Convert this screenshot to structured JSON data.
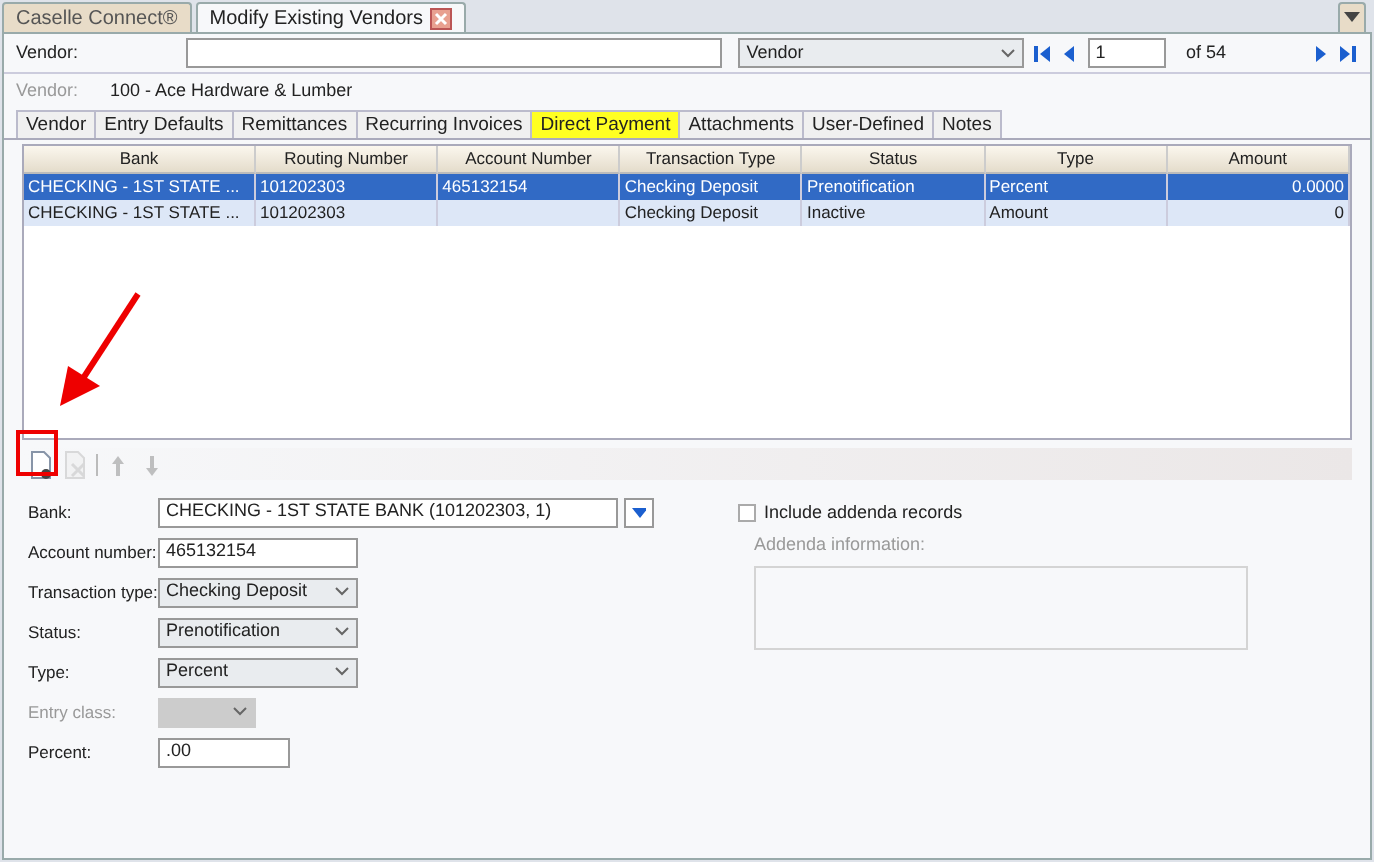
{
  "doc_tabs": [
    {
      "label": "Caselle Connect®",
      "selected": false,
      "closable": false
    },
    {
      "label": "Modify Existing Vendors",
      "selected": true,
      "closable": true
    }
  ],
  "search": {
    "label": "Vendor:",
    "field_select": "Vendor",
    "record": "1",
    "of": "of 54"
  },
  "vendor_info": {
    "label": "Vendor:",
    "value": "100  - Ace Hardware & Lumber"
  },
  "tabs": [
    {
      "label": "Vendor",
      "selected": false
    },
    {
      "label": "Entry Defaults",
      "selected": false
    },
    {
      "label": "Remittances",
      "selected": false
    },
    {
      "label": "Recurring Invoices",
      "selected": false
    },
    {
      "label": "Direct Payment",
      "selected": true
    },
    {
      "label": "Attachments",
      "selected": false
    },
    {
      "label": "User-Defined",
      "selected": false
    },
    {
      "label": "Notes",
      "selected": false
    }
  ],
  "table": {
    "columns": [
      "Bank",
      "Routing Number",
      "Account Number",
      "Transaction Type",
      "Status",
      "Type",
      "Amount"
    ],
    "rows": [
      {
        "selected": true,
        "cells": [
          "CHECKING - 1ST STATE ...",
          "101202303",
          "465132154",
          "Checking Deposit",
          "Prenotification",
          "Percent",
          "0.0000"
        ]
      },
      {
        "selected": false,
        "cells": [
          "CHECKING - 1ST STATE ...",
          "101202303",
          "",
          "Checking Deposit",
          "Inactive",
          "Amount",
          "0"
        ]
      }
    ]
  },
  "toolbar": [
    {
      "kind": "new",
      "disabled": false
    },
    {
      "kind": "delete",
      "disabled": true
    },
    {
      "kind": "up",
      "disabled": true
    },
    {
      "kind": "down",
      "disabled": true
    }
  ],
  "form": [
    {
      "kind": "lookup",
      "label": "Bank:",
      "value": "CHECKING - 1ST STATE BANK (101202303, 1)",
      "disabled": false
    },
    {
      "kind": "text",
      "label": "Account number:",
      "value": "465132154",
      "disabled": false
    },
    {
      "kind": "select",
      "label": "Transaction type:",
      "value": "Checking Deposit",
      "disabled": false
    },
    {
      "kind": "select",
      "label": "Status:",
      "value": "Prenotification",
      "disabled": false
    },
    {
      "kind": "select",
      "label": "Type:",
      "value": "Percent",
      "disabled": false
    },
    {
      "kind": "select",
      "label": "Entry class:",
      "disabled": true
    },
    {
      "kind": "text",
      "label": "Percent:",
      "value": ".00",
      "disabled": false
    }
  ],
  "addenda": {
    "checkbox_label": "Include addenda records",
    "checked": false,
    "info_label": "Addenda information:",
    "disabled": true
  },
  "annotation": {
    "arrow": true,
    "highlight_new_button": true
  }
}
